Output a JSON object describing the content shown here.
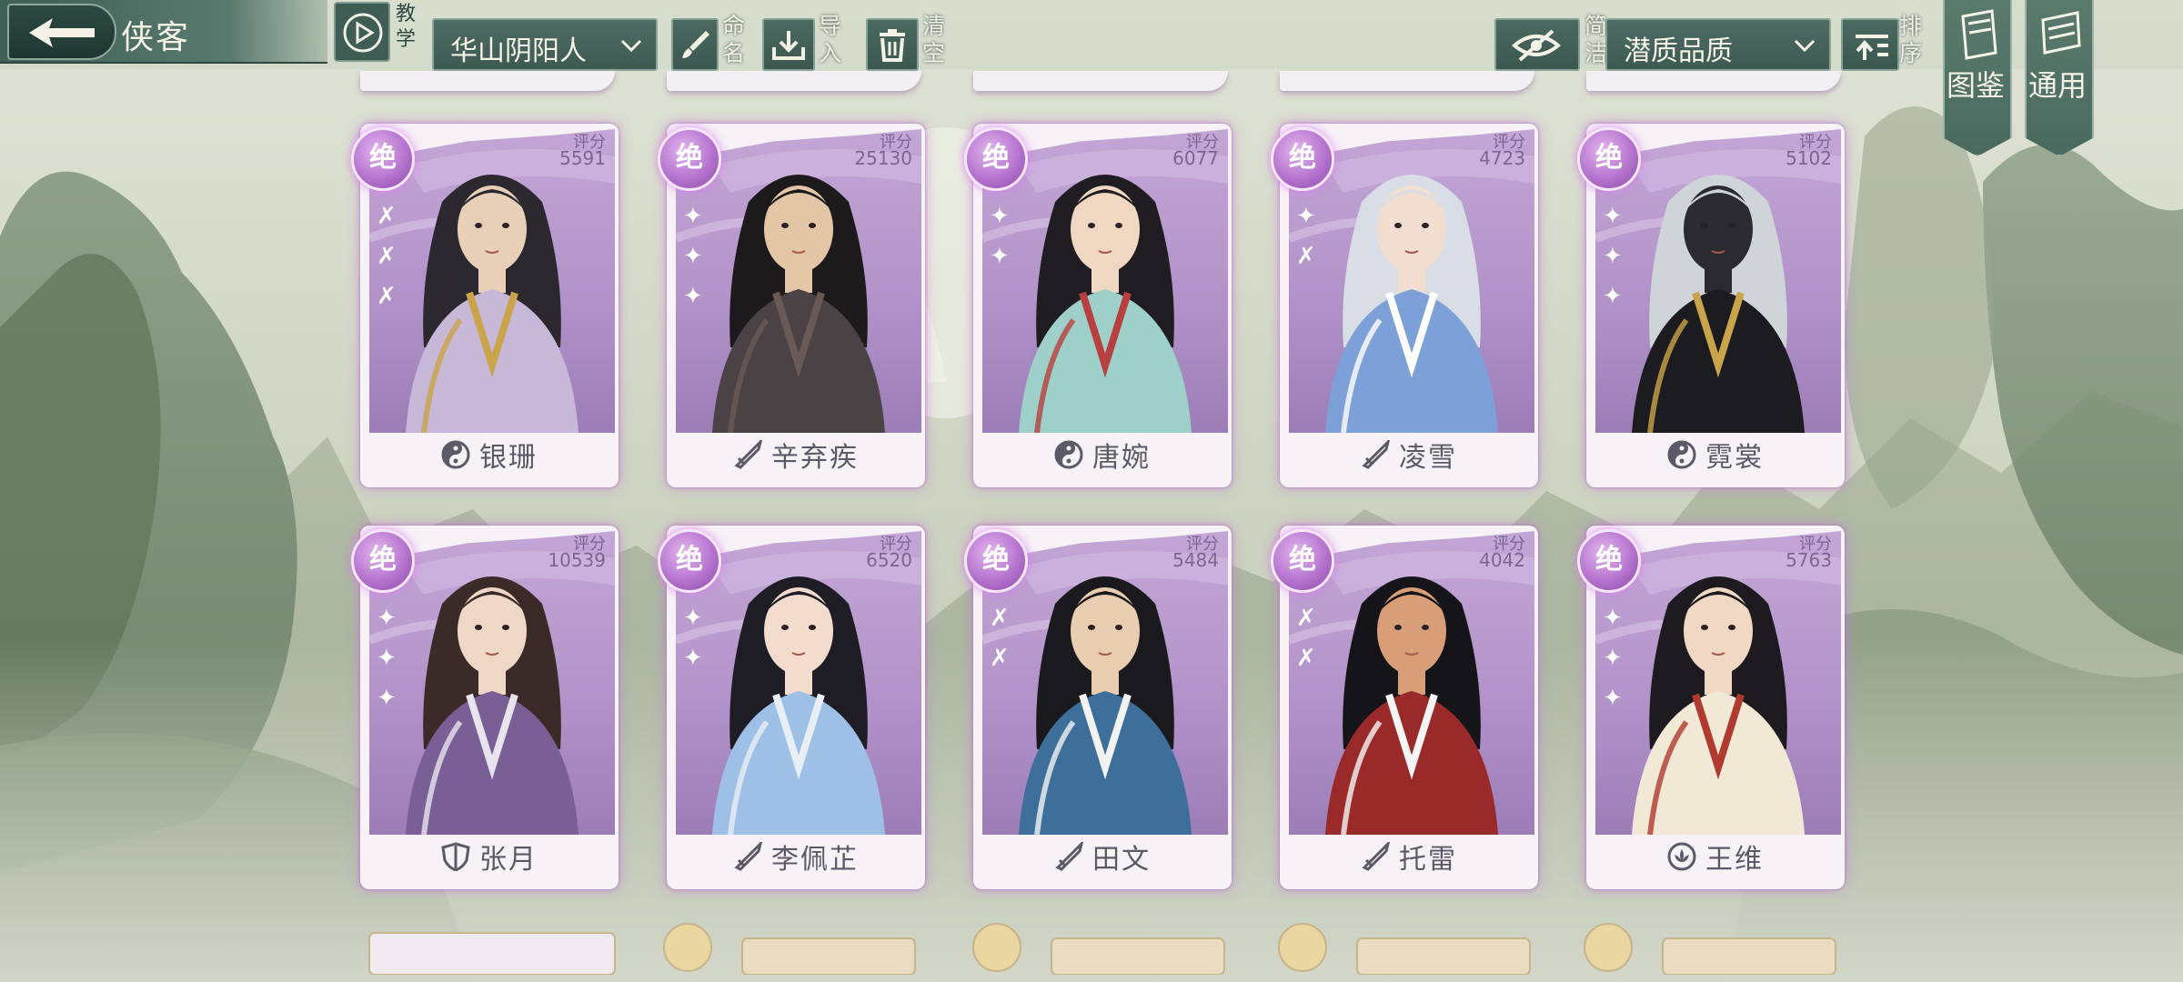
{
  "header": {
    "title": "侠客",
    "tutorial_label": "教学",
    "faction_filter": "华山阴阳人",
    "name_label": "命名",
    "import_label": "导入",
    "clear_label": "清空",
    "brief_label": "简洁",
    "quality_sort": "潜质品质",
    "sort_label": "排序",
    "codex_label": "图鉴",
    "general_label": "通用"
  },
  "rating_label": "评分",
  "cards": [
    {
      "grade": "绝",
      "rating": "5591",
      "name": "银珊",
      "sect": "yin-yang-icon",
      "stars": "✗✗✗",
      "palette": [
        "#2c2830",
        "#e8d0b8",
        "#c8b8d8",
        "#c9a44a"
      ]
    },
    {
      "grade": "绝",
      "rating": "25130",
      "name": "辛弃疾",
      "sect": "sword-icon",
      "stars": "✦✦✦",
      "palette": [
        "#1d1a1c",
        "#e3c6a6",
        "#4a4245",
        "#6a5a55"
      ]
    },
    {
      "grade": "绝",
      "rating": "6077",
      "name": "唐婉",
      "sect": "yin-yang-icon",
      "stars": "✦✦",
      "palette": [
        "#1f1c22",
        "#f0d7c2",
        "#9ed0c9",
        "#b84040"
      ]
    },
    {
      "grade": "绝",
      "rating": "4723",
      "name": "凌雪",
      "sect": "sword-icon",
      "stars": "✦✗",
      "palette": [
        "#d8dde6",
        "#f1ded0",
        "#7ea0d8",
        "#ffffff"
      ]
    },
    {
      "grade": "绝",
      "rating": "5102",
      "name": "霓裳",
      "sect": "yin-yang-icon",
      "stars": "✦✦✦",
      "palette": [
        "#cfd4d8",
        "#2b2a2f",
        "#1c1b20",
        "#c9a44a"
      ]
    },
    {
      "grade": "绝",
      "rating": "10539",
      "name": "张月",
      "sect": "shield-icon",
      "stars": "✦✦✦",
      "palette": [
        "#3a2a28",
        "#eed7c5",
        "#7a5e96",
        "#e8e4ee"
      ]
    },
    {
      "grade": "绝",
      "rating": "6520",
      "name": "李佩芷",
      "sect": "sword-icon",
      "stars": "✦✦",
      "palette": [
        "#1e1c24",
        "#f3dccd",
        "#9fc0e6",
        "#e8eef6"
      ]
    },
    {
      "grade": "绝",
      "rating": "5484",
      "name": "田文",
      "sect": "sword-icon",
      "stars": "✗✗",
      "palette": [
        "#1a1a1e",
        "#e9cdb0",
        "#3d6f9a",
        "#f2f2f2"
      ]
    },
    {
      "grade": "绝",
      "rating": "4042",
      "name": "托雷",
      "sect": "sword-icon",
      "stars": "✗✗",
      "palette": [
        "#151418",
        "#d89e78",
        "#9a2a2a",
        "#f5f5f5"
      ]
    },
    {
      "grade": "绝",
      "rating": "5763",
      "name": "王维",
      "sect": "lotus-icon",
      "stars": "✦✦✦",
      "palette": [
        "#1d1b20",
        "#f0d8c4",
        "#f1e9d6",
        "#b03a30"
      ]
    }
  ],
  "colors": {
    "accent": "#4f6d64",
    "card_purple": "#b293c9",
    "badge_glow": "#d37ef0"
  }
}
